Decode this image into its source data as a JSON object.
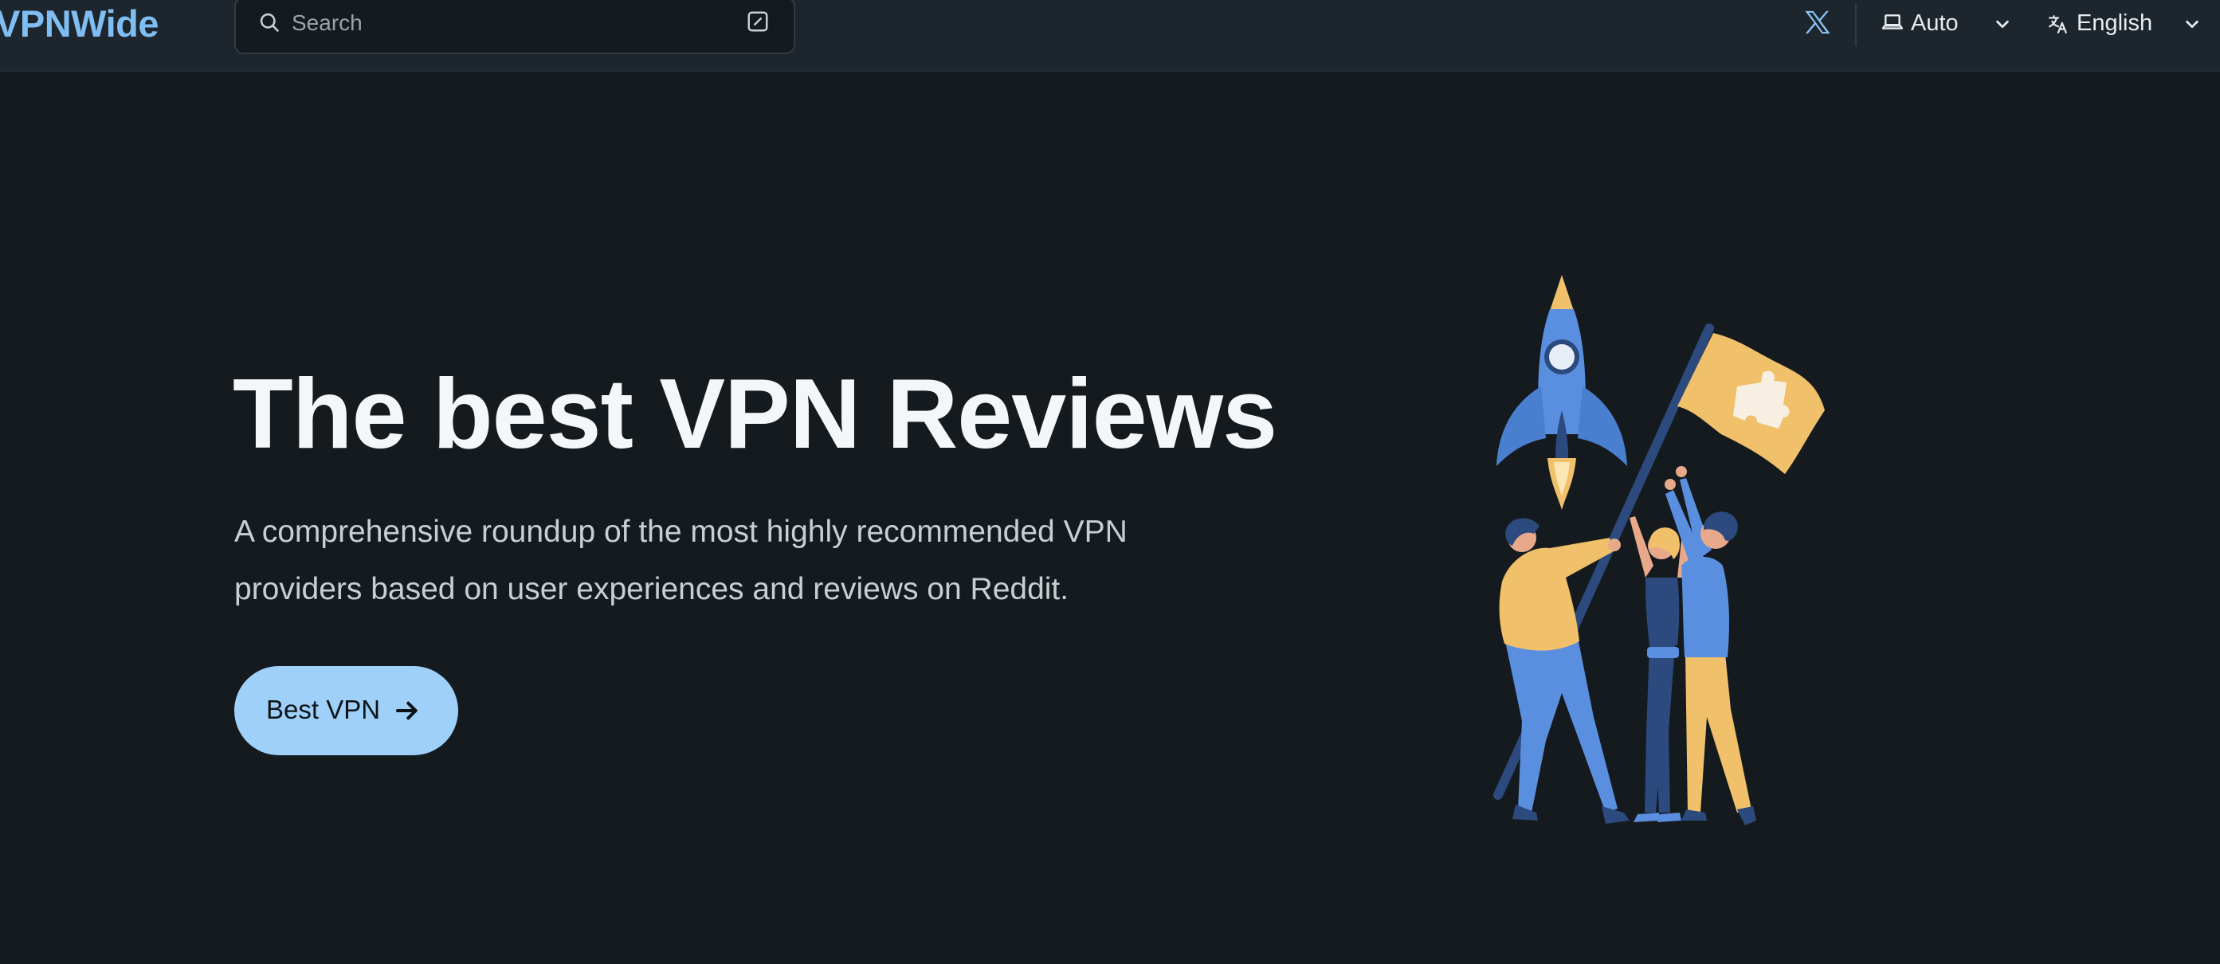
{
  "header": {
    "brand": "VPNWide",
    "search": {
      "placeholder": "Search"
    },
    "theme": {
      "label": "Auto"
    },
    "language": {
      "label": "English"
    },
    "icons": {
      "search": "search-icon",
      "keyboard": "slash-shortcut-icon",
      "social": "x-twitter-icon",
      "theme": "laptop-icon",
      "language": "translate-icon",
      "dropdown": "chevron-down-icon"
    }
  },
  "hero": {
    "title": "The best VPN Reviews",
    "subtitle": "A comprehensive roundup of the most highly recommended VPN providers based on user experiences and reviews on Reddit.",
    "cta": {
      "label": "Best VPN",
      "icon": "arrow-right-icon"
    }
  },
  "colors": {
    "background": "#141a1d",
    "header": "#1d262c",
    "brand": "#7fbdf3",
    "cta": "#9fd0f9",
    "illustration_blue": "#5a8fe0",
    "illustration_yellow": "#f0c06a",
    "illustration_navy": "#2c4a7e"
  }
}
